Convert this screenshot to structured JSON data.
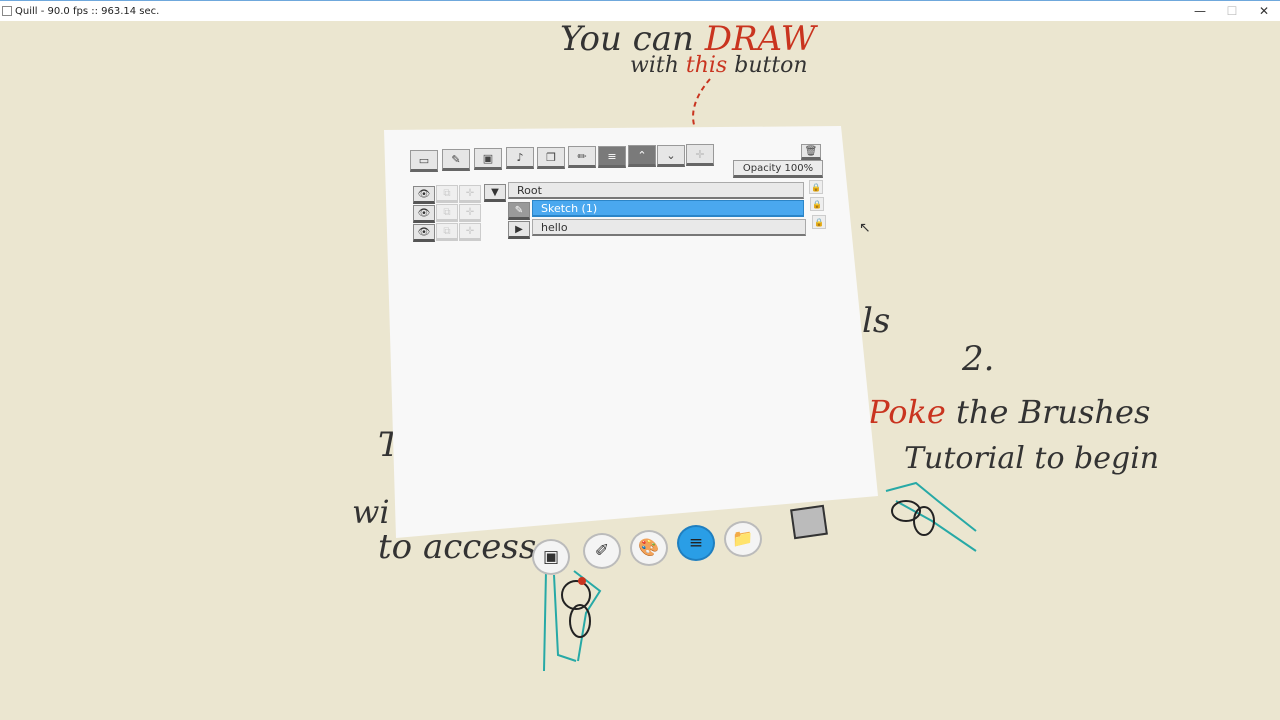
{
  "window": {
    "title": "Quill - 90.0 fps :: 963.14 sec.",
    "controls": {
      "minimize": "—",
      "maximize": "☐",
      "close": "✕"
    }
  },
  "background_notes": {
    "top_line1": "You can",
    "top_line1_accent": "DRAW",
    "top_line2_prefix": "with",
    "top_line2_accent": "this",
    "top_line2_suffix": "button",
    "tools_fragment": "ls",
    "step_number": "2.",
    "poke_accent": "Poke",
    "poke_rest": "the Brushes",
    "tutorial_line": "Tutorial to begin",
    "left_fragment1": "T",
    "left_fragment2": "wi",
    "left_fragment3": "to access"
  },
  "panel": {
    "toolbar": [
      {
        "icon": "new-folder-icon",
        "glyph": "▭"
      },
      {
        "icon": "new-paint-layer-icon",
        "glyph": "✎"
      },
      {
        "icon": "new-picture-layer-icon",
        "glyph": "▣"
      },
      {
        "icon": "new-sound-layer-icon",
        "glyph": "♪"
      },
      {
        "icon": "duplicate-icon",
        "glyph": "❐"
      },
      {
        "icon": "pen-icon",
        "glyph": "✏"
      },
      {
        "icon": "layer-stack-icon",
        "glyph": "≡"
      },
      {
        "icon": "move-up-icon",
        "glyph": "⌃"
      },
      {
        "icon": "move-down-icon",
        "glyph": "⌄"
      },
      {
        "icon": "transform-icon",
        "glyph": "✛"
      }
    ],
    "opacity_label": "Opacity 100%",
    "trash_glyph": "🗑",
    "layers": [
      {
        "name": "Root",
        "expander": "▼",
        "selected": false
      },
      {
        "name": "Sketch (1)",
        "expander": "✎",
        "selected": true
      },
      {
        "name": "hello",
        "expander": "▶",
        "selected": false
      }
    ],
    "row_glyphs": {
      "visibility": "👁",
      "link": "⧉",
      "move": "✛",
      "lock": "🔒"
    }
  },
  "menu_buttons": [
    {
      "icon": "picture-icon",
      "glyph": "▣",
      "active": false
    },
    {
      "icon": "brushes-icon",
      "glyph": "✐",
      "active": false
    },
    {
      "icon": "palette-icon",
      "glyph": "🎨",
      "active": false
    },
    {
      "icon": "layers-icon",
      "glyph": "≡",
      "active": true
    },
    {
      "icon": "folder-icon",
      "glyph": "📁",
      "active": false
    }
  ],
  "colors": {
    "accent": "#2a9ee6",
    "selection": "#4aa8ef",
    "annotation_red": "#c9341f",
    "background": "#ebe6d0",
    "controller_teal": "#27a9a6"
  }
}
